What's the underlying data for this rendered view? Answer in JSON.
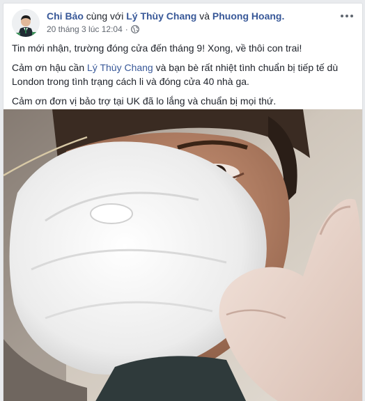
{
  "post": {
    "author": "Chi Bảo",
    "with_word": "cùng với",
    "tag1": "Lý Thùy Chang",
    "and_word": "và",
    "tag2": "Phuong Hoang.",
    "timestamp": "20 tháng 3 lúc 12:04",
    "dot": "·",
    "privacy_icon": "globe-icon",
    "more_icon": "more-options-icon",
    "paragraph1": "Tin mới nhận, trường đóng cửa đến tháng 9! Xong, về thôi con trai!",
    "p2_before": "Cảm ơn hậu cần ",
    "p2_mention": "Lý Thùy Chang",
    "p2_after": " và bạn bè rất nhiệt tình chuẩn bị tiếp tế dù London trong tình trạng cách li và đóng cửa 40 nhà ga.",
    "paragraph3": "Cảm ơn đơn vị bảo trợ tại UK đã lo lắng và chuẩn bị mọi thứ."
  },
  "colors": {
    "link": "#385898",
    "text": "#1d2129",
    "meta": "#616770",
    "background": "#e9ebee"
  }
}
